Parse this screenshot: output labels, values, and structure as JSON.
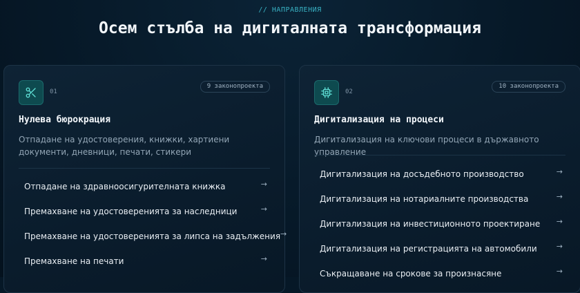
{
  "section": {
    "eyebrow": "// НАПРАВЛЕНИЯ",
    "title": "Осем стълба на дигиталната трансформация"
  },
  "cards": [
    {
      "number": "01",
      "icon": "scissors-icon",
      "badge": "9 законопроекта",
      "title": "Нулева бюрокрация",
      "description": "Отпадане на удостоверения, книжки, хартиени документи, дневници, печати, стикери",
      "items": [
        "Отпадане на здравноосигурителната книжка",
        "Премахване на удостоверенията за наследници",
        "Премахване на удостоверенията за липса на задължения",
        "Премахване на печати"
      ]
    },
    {
      "number": "02",
      "icon": "chip-icon",
      "badge": "10 законопроекта",
      "title": "Дигитализация на процеси",
      "description": "Дигитализация на ключови процеси в държавното управление",
      "items": [
        "Дигитализация на досъдебното производство",
        "Дигитализация на нотариалните производства",
        "Дигитализация на инвестиционното проектиране",
        "Дигитализация на регистрацията на автомобили",
        "Съкращаване на срокове за произнасяне"
      ]
    }
  ],
  "colors": {
    "background": "#061827",
    "accent": "#38b2c4",
    "icon_bg": "#0e4a4f"
  }
}
